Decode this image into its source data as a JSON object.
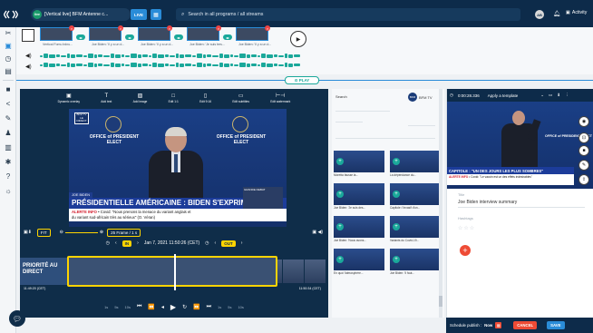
{
  "topbar": {
    "stream_badge": "live",
    "stream_title": "[Vertical live] BFM Antenne c...",
    "live_label": "LIVE",
    "search_placeholder": "Search in all programs / all streams",
    "user_initials": "AB",
    "activity_label": "Activity"
  },
  "clips": [
    {
      "label": "Vertical Fomu lrdnu..."
    },
    {
      "label": "Joe Biden: 'Il y a un d..."
    },
    {
      "label": "Joe Biden: 'Il y a un d..."
    },
    {
      "label": "Joe Biden: 'Je suis tres..."
    },
    {
      "label": "Joe Biden: 'Il y a un d..."
    }
  ],
  "play_button_label": "PLAY",
  "editor_tools": [
    {
      "label": "Dynamic overlay",
      "icon": "overlay-icon"
    },
    {
      "label": "Add text",
      "icon": "text-icon"
    },
    {
      "label": "Add image",
      "icon": "image-icon"
    },
    {
      "label": "Edit 1:1",
      "icon": "crop-square-icon"
    },
    {
      "label": "Edit 9:16",
      "icon": "crop-vertical-icon"
    },
    {
      "label": "Edit subtitles",
      "icon": "subtitles-icon"
    },
    {
      "label": "Edit watermark",
      "icon": "watermark-icon"
    }
  ],
  "video": {
    "logo": "BFM TV LE DIRECT",
    "office_left": "OFFICE of PRESIDENT ELECT",
    "office_right": "OFFICE of PRESIDENT ELECT",
    "name_tag": "JOE BIDEN",
    "chyron": "PRÉSIDENTIELLE AMÉRICAINE : BIDEN S'EXPRIME",
    "ticker_alert": "ALERTE INFO",
    "ticker_text": "Covid: \"Nous prenons la menace du variant anglais et",
    "ticker_text2": "du variant sud-africain très au sérieux\" (O. Véran)",
    "inset_text": "GRANDE DEBAT"
  },
  "controls": {
    "fit_label": "FIT",
    "fps_label": "25 Frame / 1 s",
    "in_label": "IN",
    "out_label": "OUT",
    "datetime": "Jan 7, 2021 11:50:26 (CET)"
  },
  "timeline": {
    "priority_label": "PRIORITÉ AU DIRECT",
    "left_time": "11:49:20 (CET)",
    "right_time": "11:50:34 (CET)"
  },
  "transport": [
    "1s",
    "5s",
    "10s",
    "IN",
    "OUT",
    "1s",
    "5s",
    "10s"
  ],
  "midpanel": {
    "header": "Search",
    "channel": "BFM TV",
    "thumbs": [
      {
        "title": "Moretta fausse la..."
      },
      {
        "title": "La dépendance du..."
      },
      {
        "title": "Joe Biden: 'Je suis des..."
      },
      {
        "title": "Capitole: l'invasif d'un..."
      },
      {
        "title": "Joe Biden: 'Nous avons..."
      },
      {
        "title": "Variants du Covid-19..."
      },
      {
        "title": "En quoi l'atmosphère..."
      },
      {
        "title": "Joe Biden: 'Il faut..."
      }
    ]
  },
  "right": {
    "timecode": "0:00:28.336",
    "template_label": "Apply a template",
    "chyron": "CAPITOLE : \"UN DES JOURS LES PLUS SOMBRES\"",
    "ticker_alert": "ALERTE INFO",
    "ticker_text": "Covid: \"Le vaccin est un des effets indésirables\"",
    "title_label": "Title",
    "title_value": "Joe Biden interview summary",
    "tags_label": "Hashtags"
  },
  "footer": {
    "schedule_label": "Schedule publish :",
    "now_label": "Now",
    "cancel_label": "CANCEL",
    "save_label": "SAVE"
  }
}
